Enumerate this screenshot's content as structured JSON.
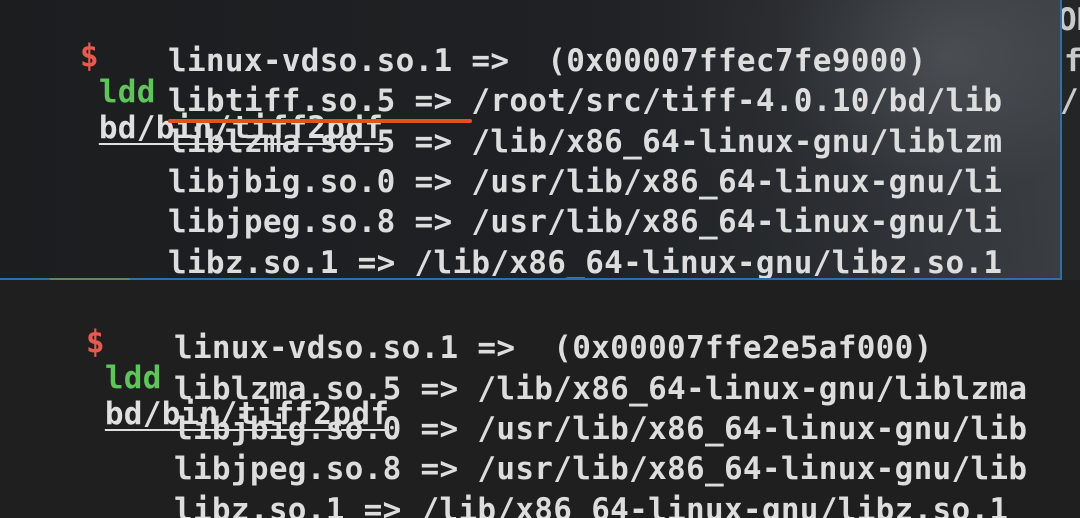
{
  "top_pane": {
    "prompt": "$",
    "command": "ldd",
    "argument": "bd/bin/tiff2pdf",
    "lines": [
      "linux-vdso.so.1 =>  (0x00007ffec7fe9000)",
      "libtiff.so.5 => /root/src/tiff-4.0.10/bd/lib",
      "liblzma.so.5 => /lib/x86_64-linux-gnu/liblzm",
      "libjbig.so.0 => /usr/lib/x86_64-linux-gnu/li",
      "libjpeg.so.8 => /usr/lib/x86_64-linux-gnu/li",
      "libz.so.1 => /lib/x86_64-linux-gnu/libz.so.1"
    ],
    "right_fragments": [
      "ON",
      "f",
      "/"
    ],
    "highlight_color": "#e0531f"
  },
  "bottom_pane": {
    "prompt": "$",
    "command": "ldd",
    "argument": "bd/bin/tiff2pdf",
    "lines": [
      "linux-vdso.so.1 =>  (0x00007ffe2e5af000)",
      "liblzma.so.5 => /lib/x86_64-linux-gnu/liblzma",
      "libjbig.so.0 => /usr/lib/x86_64-linux-gnu/lib",
      "libjpeg.so.8 => /usr/lib/x86_64-linux-gnu/lib",
      "libz.so.1 => /lib/x86_64-linux-gnu/libz.so.1"
    ]
  },
  "colors": {
    "prompt": "#e85a4f",
    "command": "#5fc45a",
    "pane_border": "#2f6fa8"
  }
}
